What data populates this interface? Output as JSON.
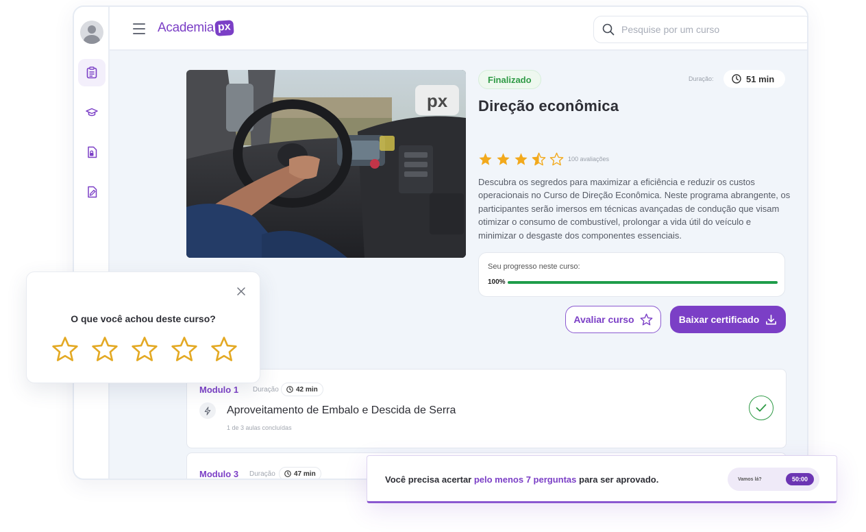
{
  "app": {
    "logo_text": "Academia",
    "logo_badge": "px"
  },
  "search": {
    "placeholder": "Pesquise por um curso"
  },
  "sidebar": {
    "items": [
      {
        "icon": "clipboard-icon",
        "active": true
      },
      {
        "icon": "graduation-cap-icon",
        "active": false
      },
      {
        "icon": "lock-file-icon",
        "active": false
      },
      {
        "icon": "pen-file-icon",
        "active": false
      }
    ]
  },
  "course": {
    "image_badge": "px",
    "status": "Finalizado",
    "duration_label": "Duração:",
    "duration": "51 min",
    "title": "Direção econômica",
    "rating": 3.5,
    "rating_max": 5,
    "reviews": "100 avaliações",
    "description": "Descubra os segredos para maximizar a eficiência e reduzir os custos operacionais no Curso de Direção Econômica. Neste programa abrangente, os participantes serão imersos em técnicas avançadas de condução que visam otimizar o consumo de combustível, prolongar a vida útil do veículo e minimizar o desgaste dos componentes essenciais.",
    "progress_label": "Seu progresso neste curso:",
    "progress_text": "100%",
    "progress_value": 1.0,
    "rate_button": "Avaliar curso",
    "download_button": "Baixar certificado"
  },
  "modules": [
    {
      "label": "Modulo 1",
      "duration_label": "Duração",
      "duration": "42 min",
      "title": "Aproveitamento de Embalo e Descida de Serra",
      "subtitle": "1 de 3 aulas concluídas",
      "completed": true
    },
    {
      "label": "Modulo 3",
      "duration_label": "Duração",
      "duration": "47 min"
    }
  ],
  "rating_popup": {
    "question": "O que você achou deste curso?",
    "stars": 5
  },
  "quiz_banner": {
    "text_before": "Você precisa acertar ",
    "text_highlight": "pelo menos 7 perguntas",
    "text_after": " para ser aprovado.",
    "cta_label": "Vamos lá?",
    "timer": "50:00"
  },
  "colors": {
    "brand": "#7b3fc6",
    "success": "#2e9a45",
    "star": "#f2a91c",
    "popup_star": "#e3a924"
  }
}
